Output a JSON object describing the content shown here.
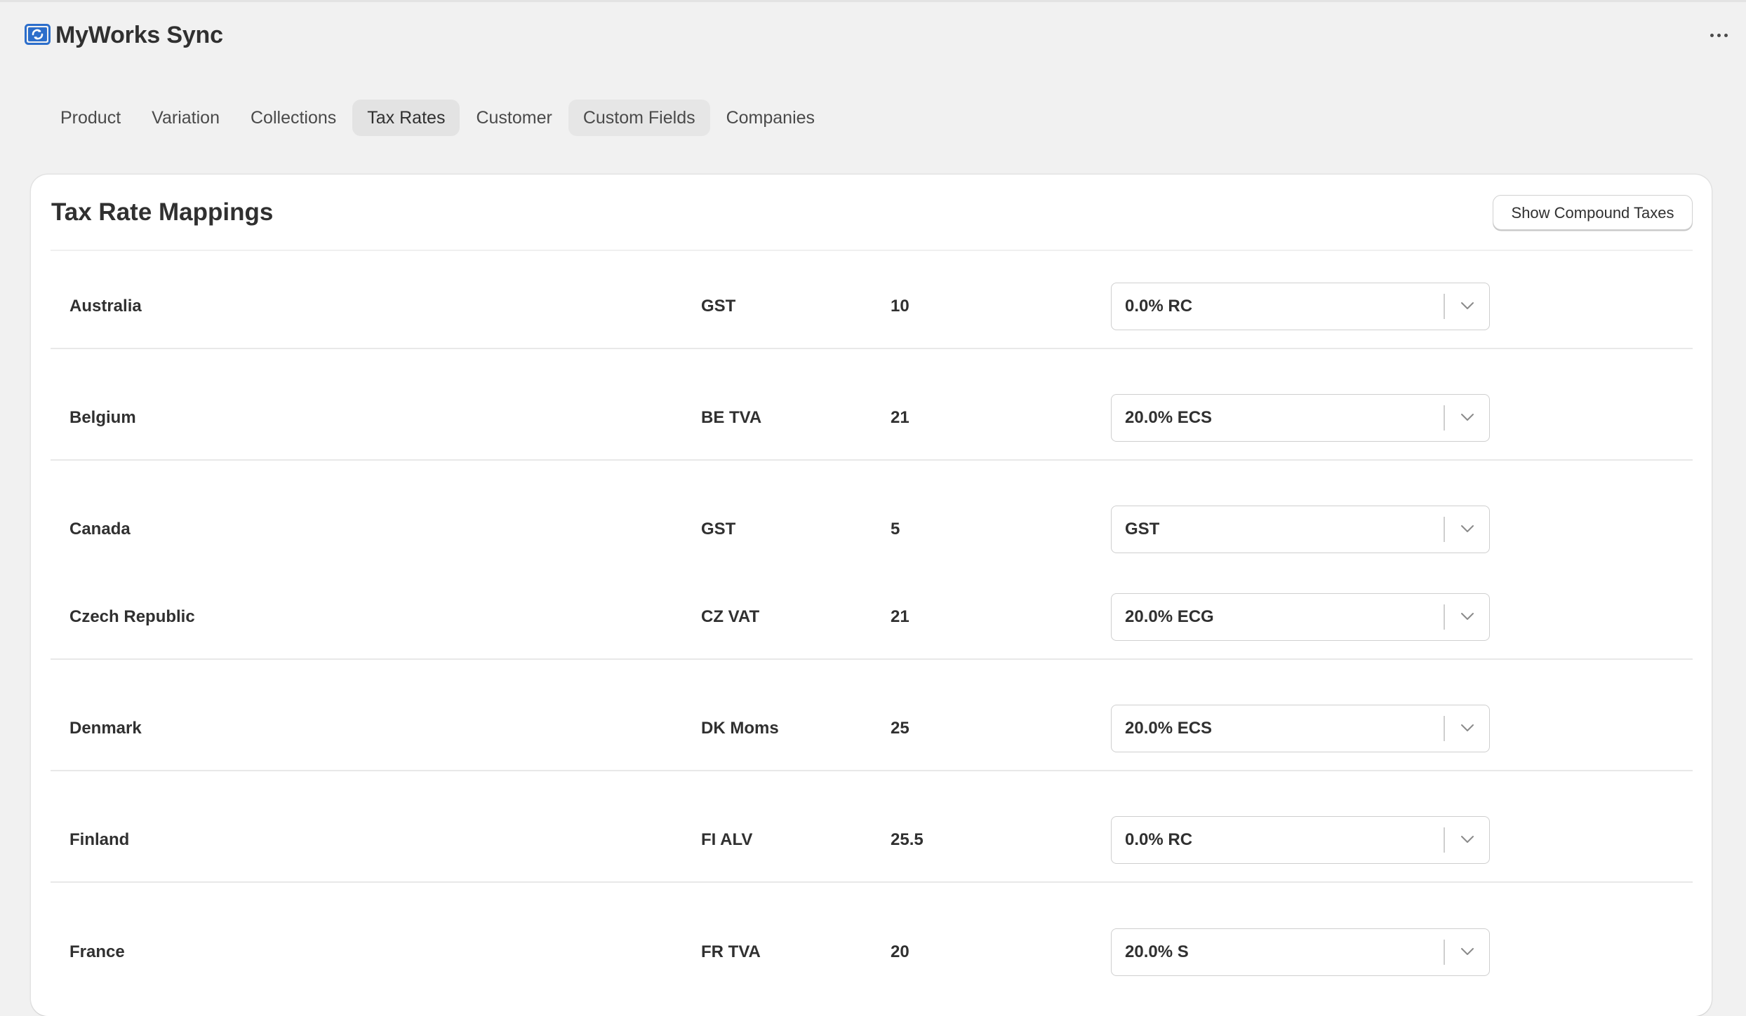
{
  "app": {
    "title": "MyWorks Sync",
    "brand_color": "#2c6ecb"
  },
  "tabs": [
    {
      "label": "Product"
    },
    {
      "label": "Variation"
    },
    {
      "label": "Collections"
    },
    {
      "label": "Tax Rates",
      "active": true
    },
    {
      "label": "Customer"
    },
    {
      "label": "Custom Fields"
    },
    {
      "label": "Companies"
    }
  ],
  "card": {
    "title": "Tax Rate Mappings",
    "compound_button": "Show Compound Taxes"
  },
  "rows": [
    {
      "country": "Australia",
      "tax_name": "GST",
      "rate": "10",
      "mapped": "0.0% RC"
    },
    {
      "country": "Belgium",
      "tax_name": "BE TVA",
      "rate": "21",
      "mapped": "20.0% ECS"
    },
    {
      "country": "Canada",
      "tax_name": "GST",
      "rate": "5",
      "mapped": "GST"
    },
    {
      "country": "Czech Republic",
      "tax_name": "CZ VAT",
      "rate": "21",
      "mapped": "20.0% ECG"
    },
    {
      "country": "Denmark",
      "tax_name": "DK Moms",
      "rate": "25",
      "mapped": "20.0% ECS"
    },
    {
      "country": "Finland",
      "tax_name": "FI ALV",
      "rate": "25.5",
      "mapped": "0.0% RC"
    },
    {
      "country": "France",
      "tax_name": "FR TVA",
      "rate": "20",
      "mapped": "20.0% S"
    }
  ]
}
